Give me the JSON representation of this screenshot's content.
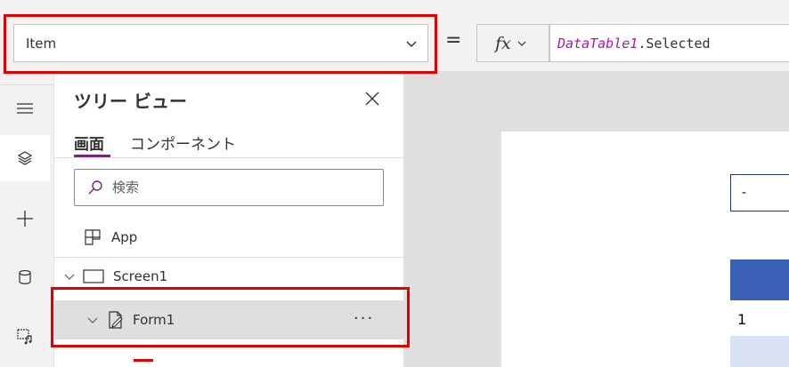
{
  "formula_bar": {
    "property": "Item",
    "equals": "=",
    "fx_label": "fx",
    "formula_control": "DataTable1",
    "formula_property": ".Selected"
  },
  "rail": {
    "items": [
      "menu-icon",
      "layers-icon",
      "add-icon",
      "data-icon",
      "media-icon"
    ]
  },
  "tree": {
    "title": "ツリー ビュー",
    "tabs": [
      "画面",
      "コンポーネント"
    ],
    "active_tab": "画面",
    "search_placeholder": "検索",
    "items": [
      {
        "label": "App"
      },
      {
        "label": "Screen1"
      },
      {
        "label": "Form1"
      }
    ],
    "more": "···"
  },
  "canvas": {
    "dropdown_value": "-",
    "table_cell": "1"
  },
  "colors": {
    "highlight": "#e00000",
    "accent": "#742774",
    "table_header": "#3a5fb7",
    "formula_control": "#a31aa3"
  }
}
